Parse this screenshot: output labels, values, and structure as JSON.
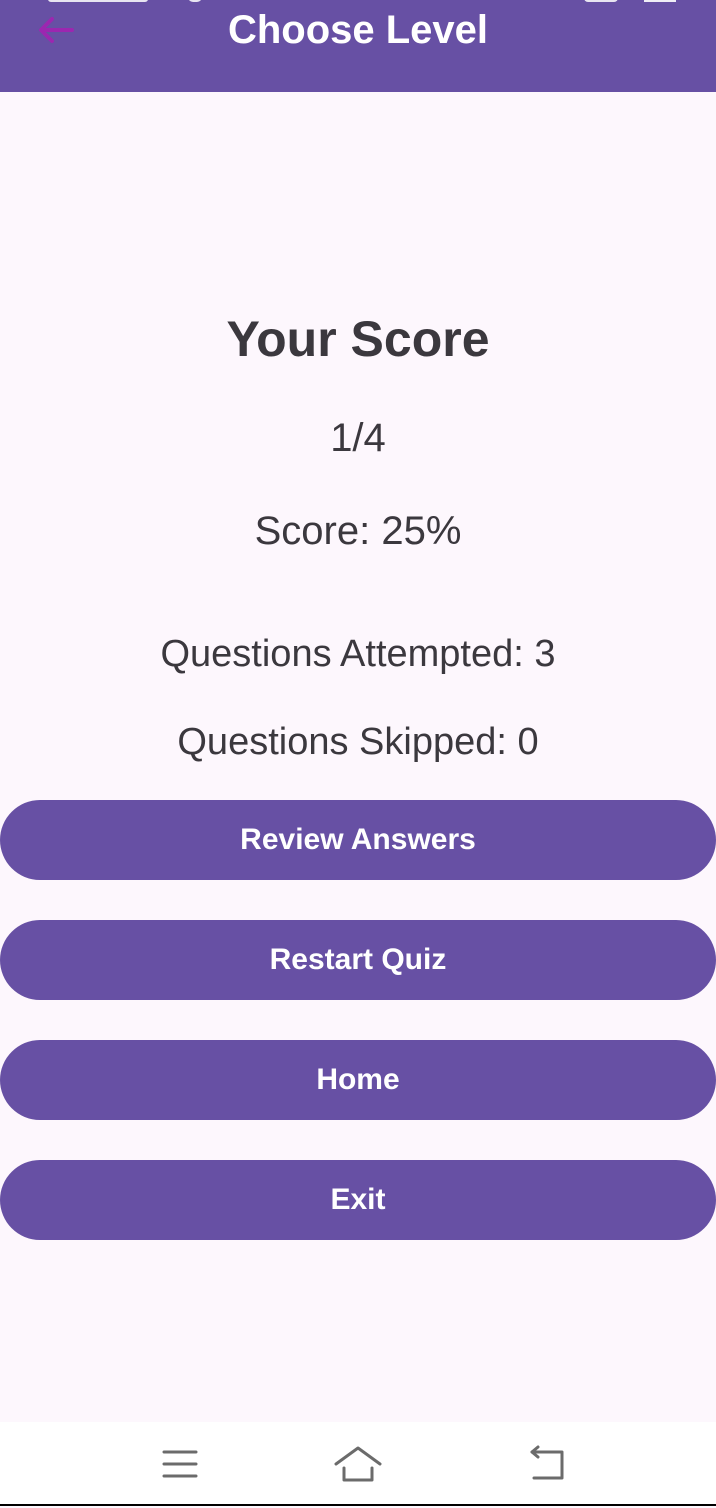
{
  "app_bar": {
    "title": "Choose Level",
    "back_icon": "arrow-left-icon",
    "back_icon_color": "#9c27b0",
    "background": "#6750a4"
  },
  "result": {
    "heading": "Your Score",
    "fraction": "1/4",
    "percentage": "Score: 25%",
    "attempted": "Questions Attempted: 3",
    "skipped": "Questions Skipped: 0"
  },
  "buttons": {
    "review": "Review Answers",
    "restart": "Restart Quiz",
    "home": "Home",
    "exit": "Exit",
    "color": "#6750a4"
  },
  "system_nav": {
    "menu_icon": "menu-lines-icon",
    "home_icon": "home-outline-icon",
    "back_icon": "return-back-icon"
  }
}
